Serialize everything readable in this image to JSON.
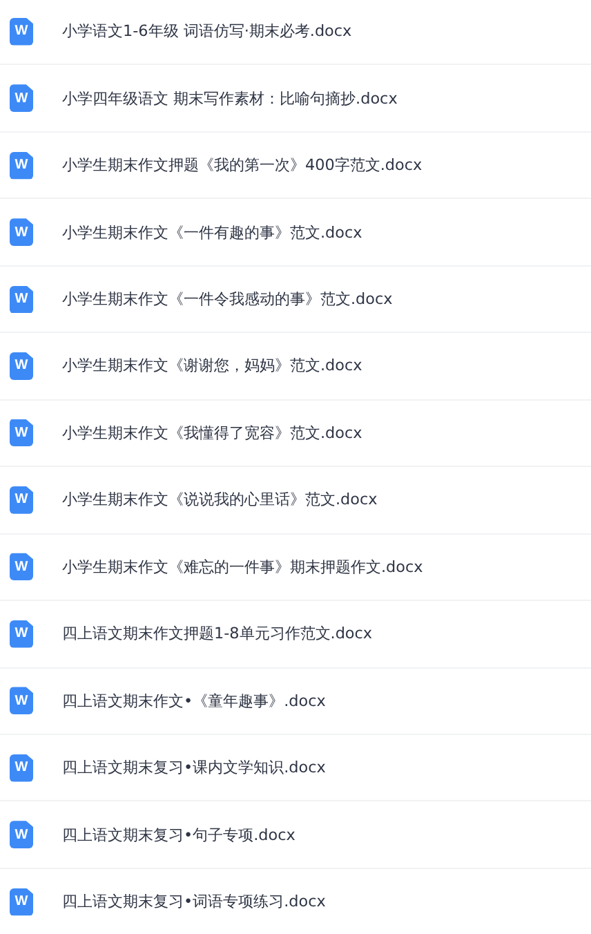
{
  "files": [
    {
      "icon_letter": "W",
      "name": "小学语文1-6年级 词语仿写·期末必考.docx"
    },
    {
      "icon_letter": "W",
      "name": "小学四年级语文 期末写作素材：比喻句摘抄.docx"
    },
    {
      "icon_letter": "W",
      "name": "小学生期末作文押题《我的第一次》400字范文.docx"
    },
    {
      "icon_letter": "W",
      "name": "小学生期末作文《一件有趣的事》范文.docx"
    },
    {
      "icon_letter": "W",
      "name": "小学生期末作文《一件令我感动的事》范文.docx"
    },
    {
      "icon_letter": "W",
      "name": "小学生期末作文《谢谢您，妈妈》范文.docx"
    },
    {
      "icon_letter": "W",
      "name": "小学生期末作文《我懂得了宽容》范文.docx"
    },
    {
      "icon_letter": "W",
      "name": "小学生期末作文《说说我的心里话》范文.docx"
    },
    {
      "icon_letter": "W",
      "name": "小学生期末作文《难忘的一件事》期末押题作文.docx"
    },
    {
      "icon_letter": "W",
      "name": "四上语文期末作文押题1-8单元习作范文.docx"
    },
    {
      "icon_letter": "W",
      "name": "四上语文期末作文•《童年趣事》.docx"
    },
    {
      "icon_letter": "W",
      "name": "四上语文期末复习•课内文学知识.docx"
    },
    {
      "icon_letter": "W",
      "name": "四上语文期末复习•句子专项.docx"
    },
    {
      "icon_letter": "W",
      "name": "四上语文期末复习•词语专项练习.docx"
    }
  ]
}
